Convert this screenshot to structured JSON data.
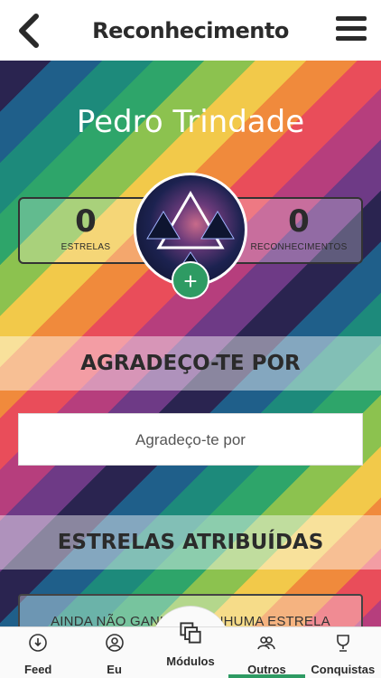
{
  "header": {
    "title": "Reconhecimento",
    "back_icon": "back-arrow-icon",
    "menu_icon": "hamburger-menu-icon"
  },
  "profile": {
    "name": "Pedro Trindade",
    "stars": {
      "count": "0",
      "label": "ESTRELAS"
    },
    "recognitions": {
      "count": "0",
      "label": "RECONHECIMENTOS"
    },
    "add_label": "+"
  },
  "thanks_section": {
    "title": "AGRADEÇO-TE POR",
    "placeholder": "Agradeço-te por"
  },
  "stars_section": {
    "title": "ESTRELAS ATRIBUÍDAS",
    "empty_text": "AINDA NÃO GANHOU NENHUMA ESTRELA"
  },
  "tabs": [
    {
      "label": "Feed",
      "icon": "feed-icon"
    },
    {
      "label": "Eu",
      "icon": "user-icon"
    },
    {
      "label": "Módulos",
      "icon": "modules-icon"
    },
    {
      "label": "Outros",
      "icon": "people-icon"
    },
    {
      "label": "Conquistas",
      "icon": "trophy-icon"
    }
  ],
  "colors": {
    "accent": "#2e9b63",
    "text": "#2b2b2b"
  }
}
